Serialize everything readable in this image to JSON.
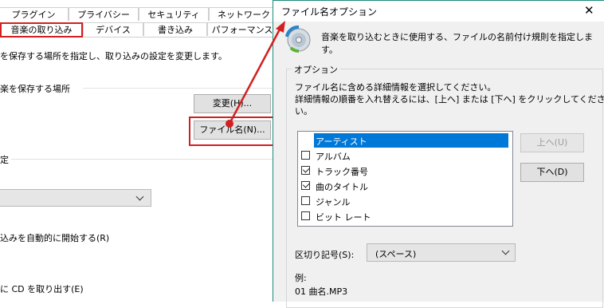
{
  "options": {
    "tabs_row1": [
      "プラグイン",
      "プライバシー",
      "セキュリティ",
      "ネットワーク"
    ],
    "tabs_row2": [
      "音楽の取り込み",
      "デバイス",
      "書き込み",
      "パフォーマンス"
    ],
    "description": "を保存する場所を指定し、取り込みの設定を変更します。",
    "section_location": "楽を保存する場所",
    "change_button": "変更(H)...",
    "filename_button": "ファイル名(N)...",
    "section_settings": "定",
    "auto_start_label": "込みを自動的に開始する(R)",
    "eject_label": "に CD を取り出す(E)"
  },
  "dialog": {
    "title": "ファイル名オプション",
    "close": "✕",
    "description": "音楽を取り込むときに使用する、ファイルの名前付け規則を指定します。",
    "options_legend": "オプション",
    "instruction_1": "ファイル名に含める詳細情報を選択してください。",
    "instruction_2": "詳細情報の順番を入れ替えるには、[上へ] または [下へ] をクリックしてくださ",
    "instruction_2b": "い。",
    "fields": [
      {
        "label": "アーティスト",
        "checked": false,
        "selected": true
      },
      {
        "label": "アルバム",
        "checked": false,
        "selected": false
      },
      {
        "label": "トラック番号",
        "checked": true,
        "selected": false
      },
      {
        "label": "曲のタイトル",
        "checked": true,
        "selected": false
      },
      {
        "label": "ジャンル",
        "checked": false,
        "selected": false
      },
      {
        "label": "ビット レート",
        "checked": false,
        "selected": false
      }
    ],
    "move_up_button": "上へ(U)",
    "move_down_button": "下へ(D)",
    "separator_label": "区切り記号(S):",
    "separator_value": "(スペース)",
    "example_label": "例:",
    "example_value": "01 曲名.MP3"
  },
  "colors": {
    "highlight_red": "#d21f1f",
    "selection_blue": "#0078d7",
    "dialog_border": "#1c8c7a"
  }
}
